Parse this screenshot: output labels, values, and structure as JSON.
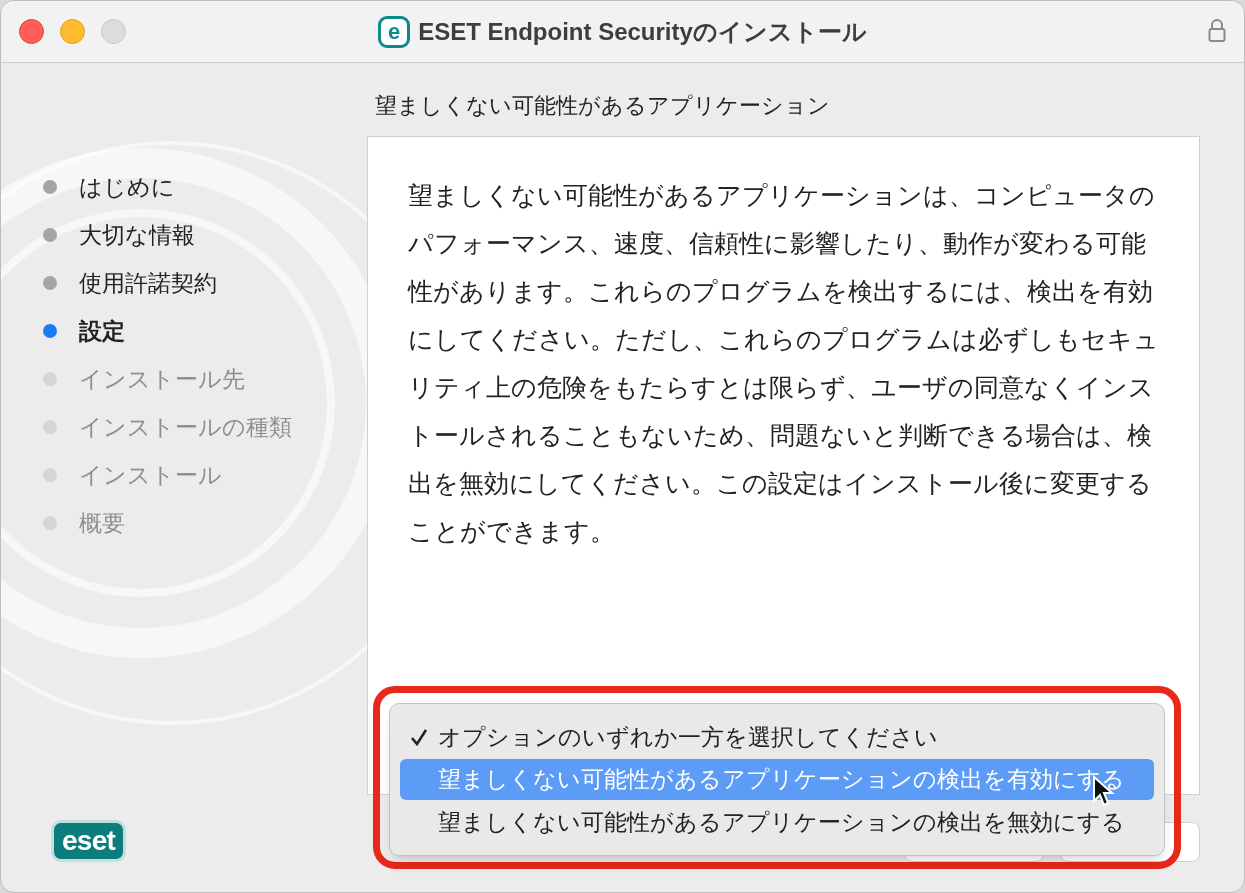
{
  "window": {
    "title_icon": "e",
    "title": "ESET Endpoint Securityのインストール"
  },
  "sidebar": {
    "steps": [
      {
        "label": "はじめに",
        "selected": false,
        "disabled": false
      },
      {
        "label": "大切な情報",
        "selected": false,
        "disabled": false
      },
      {
        "label": "使用許諾契約",
        "selected": false,
        "disabled": false
      },
      {
        "label": "設定",
        "selected": true,
        "disabled": false
      },
      {
        "label": "インストール先",
        "selected": false,
        "disabled": true
      },
      {
        "label": "インストールの種類",
        "selected": false,
        "disabled": true
      },
      {
        "label": "インストール",
        "selected": false,
        "disabled": true
      },
      {
        "label": "概要",
        "selected": false,
        "disabled": true
      }
    ],
    "logo_text": "eset"
  },
  "content": {
    "heading": "望ましくない可能性があるアプリケーション",
    "body": "望ましくない可能性があるアプリケーションは、コンピュータのパフォーマンス、速度、信頼性に影響したり、動作が変わる可能性があります。これらのプログラムを検出するには、検出を有効にしてください。ただし、これらのプログラムは必ずしもセキュリティ上の危険をもたらすとは限らず、ユーザの同意なくインストールされることもないため、問題ないと判断できる場合は、検出を無効にしてください。この設定はインストール後に変更することができます。"
  },
  "menu": {
    "items": [
      {
        "label": "オプションのいずれか一方を選択してください",
        "checked": true,
        "selected": false
      },
      {
        "label": "望ましくない可能性があるアプリケーションの検出を有効にする",
        "checked": false,
        "selected": true
      },
      {
        "label": "望ましくない可能性があるアプリケーションの検出を無効にする",
        "checked": false,
        "selected": false
      }
    ]
  }
}
